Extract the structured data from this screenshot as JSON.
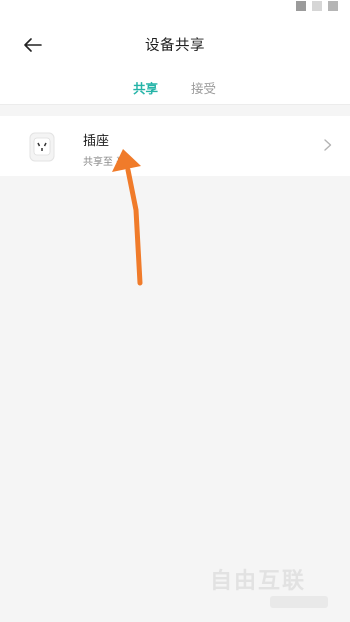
{
  "header": {
    "title": "设备共享",
    "back_icon": "arrow-left-icon"
  },
  "tabs": [
    {
      "label": "共享",
      "active": true
    },
    {
      "label": "接受",
      "active": false
    }
  ],
  "device": {
    "name": "插座",
    "subtitle": "共享至 哥",
    "thumb_icon": "power-socket-icon",
    "chevron_icon": "chevron-right-icon"
  },
  "annotation": {
    "icon": "arrow-up-icon",
    "color": "#f07b2a"
  },
  "watermark": {
    "text": "自由互联"
  },
  "colors": {
    "accent": "#26b4a8",
    "tab_inactive": "#9a9a9a",
    "background": "#f5f5f5"
  }
}
